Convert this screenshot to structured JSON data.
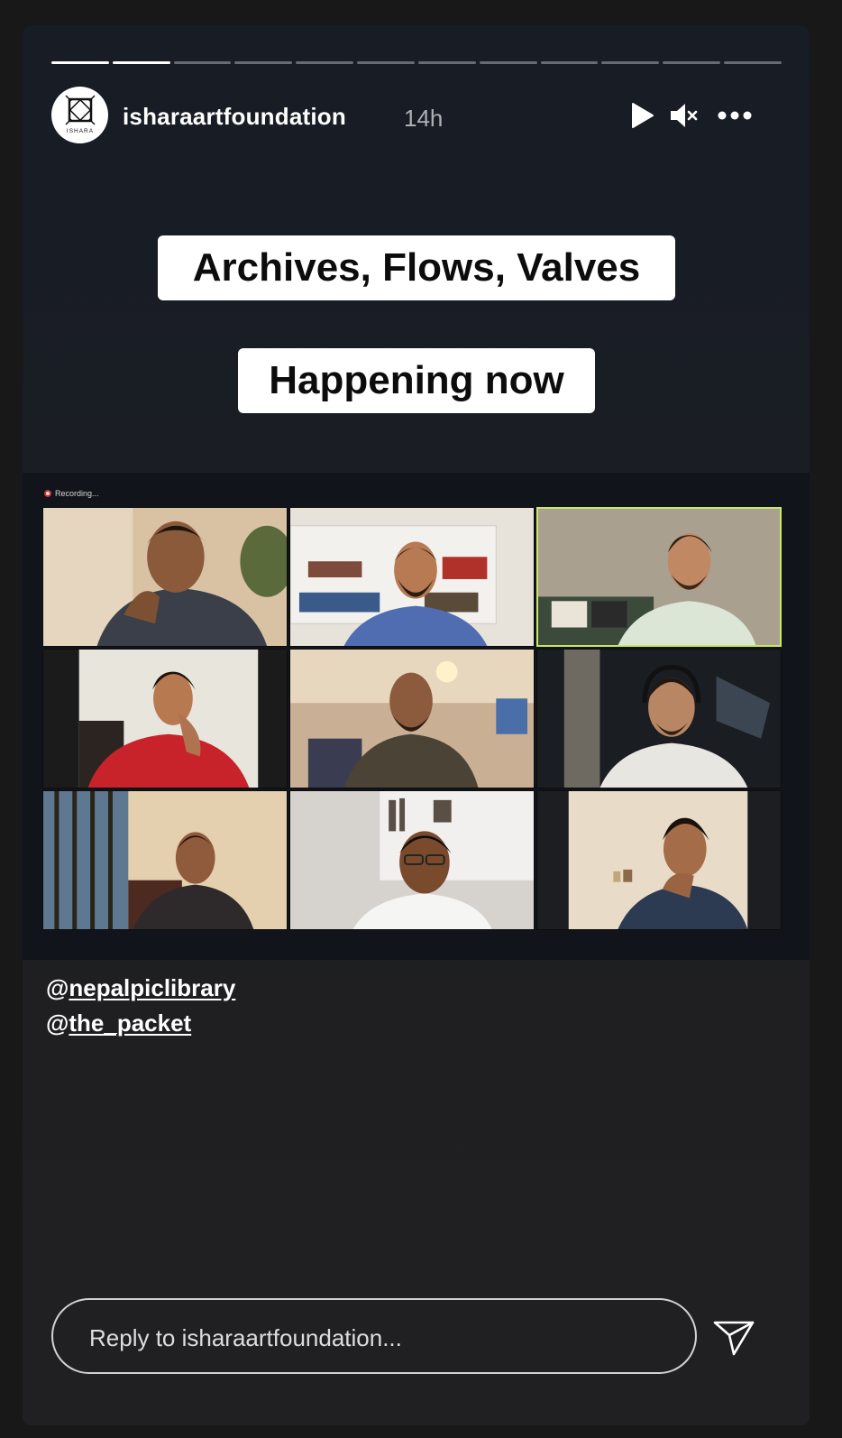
{
  "story": {
    "progress": {
      "total": 12,
      "completed": 2
    },
    "header": {
      "username": "isharaartfoundation",
      "time": "14h",
      "avatar_text": "ISHARA",
      "controls": [
        "play-icon",
        "mute-icon",
        "more-icon"
      ]
    },
    "stickers": {
      "title": "Archives, Flows, Valves",
      "subtitle": "Happening now"
    },
    "zoom": {
      "recording_label": "Recording...",
      "participants": 9,
      "active_speaker_index": 2
    },
    "mentions": [
      {
        "at": "@",
        "handle": "nepalpiclibrary"
      },
      {
        "at": "@",
        "handle": "the_packet"
      }
    ],
    "reply": {
      "placeholder": "Reply to isharaartfoundation..."
    },
    "colors": {
      "background": "#181818",
      "panel": "#1c1f25",
      "active_speaker_border": "#c9e86a"
    }
  }
}
